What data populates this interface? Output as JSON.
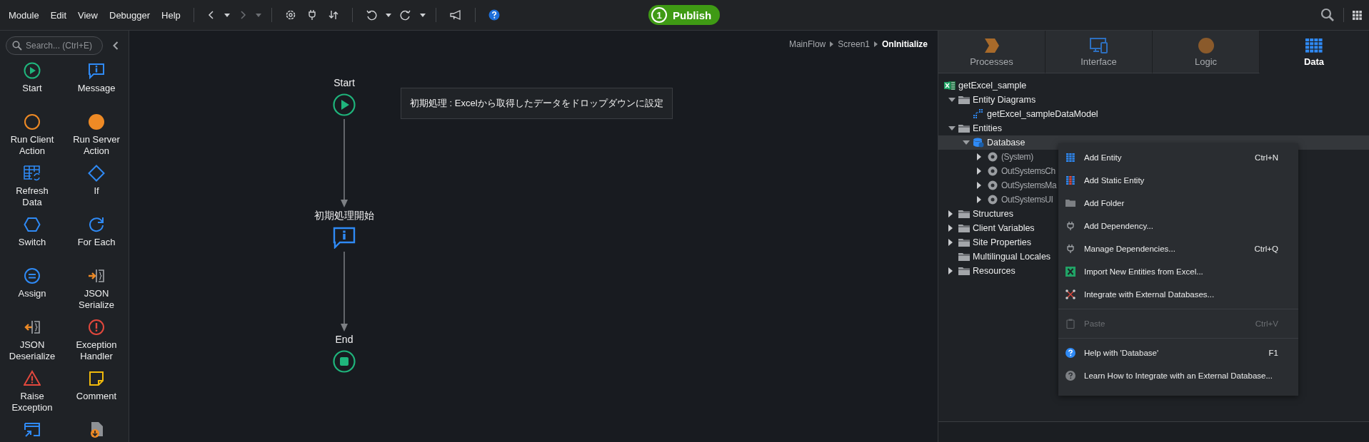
{
  "menu_bar": [
    "Module",
    "Edit",
    "View",
    "Debugger",
    "Help"
  ],
  "publish": {
    "number": "1",
    "label": "Publish"
  },
  "toolbox": {
    "search": {
      "placeholder": "Search... (Ctrl+E)"
    },
    "items": [
      {
        "kind": "start",
        "label": "Start"
      },
      {
        "kind": "message",
        "label": "Message"
      },
      {
        "kind": "client-action",
        "label": "Run Client Action"
      },
      {
        "kind": "server-action",
        "label": "Run Server Action"
      },
      {
        "kind": "refresh",
        "label": "Refresh Data"
      },
      {
        "kind": "if",
        "label": "If"
      },
      {
        "kind": "switch",
        "label": "Switch"
      },
      {
        "kind": "foreach",
        "label": "For Each"
      },
      {
        "kind": "assign",
        "label": "Assign"
      },
      {
        "kind": "json-serialize",
        "label": "JSON Serialize"
      },
      {
        "kind": "json-deserialize",
        "label": "JSON Deserialize"
      },
      {
        "kind": "exception-handler",
        "label": "Exception Handler"
      },
      {
        "kind": "raise",
        "label": "Raise Exception"
      },
      {
        "kind": "comment",
        "label": "Comment"
      },
      {
        "kind": "screen"
      },
      {
        "kind": "download"
      }
    ]
  },
  "canvas": {
    "breadcrumb": [
      {
        "label": "MainFlow",
        "current": false
      },
      {
        "label": "Screen1",
        "current": false
      },
      {
        "label": "OnInitialize",
        "current": true
      }
    ],
    "nodes": [
      {
        "kind": "start",
        "label": "Start"
      },
      {
        "kind": "message",
        "label": "初期処理開始"
      },
      {
        "kind": "end",
        "label": "End"
      }
    ],
    "comment": "初期処理 : Excelから取得したデータをドロップダウンに設定"
  },
  "panel": {
    "tabs": [
      {
        "kind": "processes",
        "label": "Processes",
        "selected": false
      },
      {
        "kind": "interface",
        "label": "Interface",
        "selected": false
      },
      {
        "kind": "logic",
        "label": "Logic",
        "selected": false
      },
      {
        "kind": "data",
        "label": "Data",
        "selected": true
      }
    ],
    "tree": [
      {
        "kind": "module",
        "label": "getExcel_sample",
        "selected": false,
        "children": [
          {
            "kind": "folder",
            "label": "Entity Diagrams",
            "selected": false,
            "expanded": true,
            "children": [
              {
                "kind": "diagram",
                "label": "getExcel_sampleDataModel",
                "selected": false
              }
            ]
          },
          {
            "kind": "folder",
            "label": "Entities",
            "selected": false,
            "expanded": true,
            "children": [
              {
                "kind": "database",
                "label": "Database",
                "selected": true,
                "expanded": true,
                "children": [
                  {
                    "kind": "reference",
                    "label": "(System)",
                    "selected": false,
                    "expanded": false
                  },
                  {
                    "kind": "reference",
                    "label": "OutSystemsCh",
                    "selected": false,
                    "expanded": false
                  },
                  {
                    "kind": "reference",
                    "label": "OutSystemsMa",
                    "selected": false,
                    "expanded": false
                  },
                  {
                    "kind": "reference",
                    "label": "OutSystemsUI",
                    "selected": false,
                    "expanded": false
                  }
                ]
              }
            ]
          },
          {
            "kind": "folder",
            "label": "Structures",
            "selected": false,
            "expanded": false
          },
          {
            "kind": "folder",
            "label": "Client Variables",
            "selected": false,
            "expanded": false
          },
          {
            "kind": "folder",
            "label": "Site Properties",
            "selected": false,
            "expanded": false
          },
          {
            "kind": "folder",
            "label": "Multilingual Locales",
            "selected": false
          },
          {
            "kind": "folder",
            "label": "Resources",
            "selected": false,
            "expanded": false
          }
        ]
      }
    ]
  },
  "context_menu": [
    {
      "kind": "entity",
      "label": "Add Entity",
      "shortcut": "Ctrl+N",
      "disabled": false
    },
    {
      "kind": "static-entity",
      "label": "Add Static Entity",
      "disabled": false
    },
    {
      "kind": "folder",
      "label": "Add Folder",
      "disabled": false
    },
    {
      "kind": "plug",
      "label": "Add Dependency...",
      "disabled": false
    },
    {
      "kind": "plug",
      "label": "Manage Dependencies...",
      "shortcut": "Ctrl+Q",
      "disabled": false
    },
    {
      "kind": "excel",
      "label": "Import New Entities from Excel...",
      "disabled": false
    },
    {
      "kind": "integrate",
      "label": "Integrate with External Databases...",
      "disabled": false
    },
    {
      "kind": "separator"
    },
    {
      "kind": "clipboard",
      "label": "Paste",
      "shortcut": "Ctrl+V",
      "disabled": true
    },
    {
      "kind": "separator"
    },
    {
      "kind": "help",
      "label": "Help with 'Database'",
      "shortcut": "F1",
      "disabled": false
    },
    {
      "kind": "question",
      "label": "Learn How to Integrate with an External Database...",
      "disabled": false
    }
  ]
}
